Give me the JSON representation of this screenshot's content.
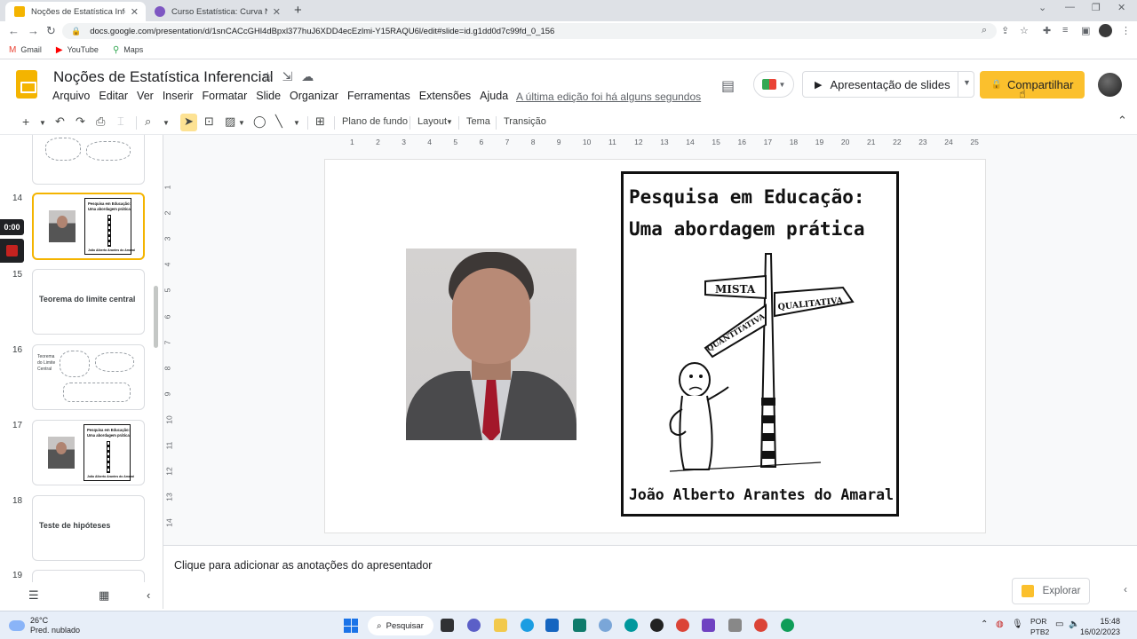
{
  "browser": {
    "tabs": [
      {
        "title": "Noções de Estatística Inferencial",
        "active": true
      },
      {
        "title": "Curso Estatística: Curva Normal",
        "active": false
      }
    ],
    "url": "docs.google.com/presentation/d/1snCACcGHl4dBpxl377huJ6XDD4ecEzlmi-Y15RAQU6l/edit#slide=id.g1dd0d7c99fd_0_156",
    "bookmarks": [
      "Gmail",
      "YouTube",
      "Maps"
    ]
  },
  "doc": {
    "title": "Noções de Estatística Inferencial",
    "menu": [
      "Arquivo",
      "Editar",
      "Ver",
      "Inserir",
      "Formatar",
      "Slide",
      "Organizar",
      "Ferramentas",
      "Extensões",
      "Ajuda"
    ],
    "last_edit": "A última edição foi há alguns segundos",
    "present_label": "Apresentação de slides",
    "share_label": "Compartilhar"
  },
  "toolbar": {
    "background": "Plano de fundo",
    "layout": "Layout",
    "theme": "Tema",
    "transition": "Transição"
  },
  "filmstrip": {
    "timer": "0:00",
    "slides": [
      {
        "num": "14",
        "selected": true
      },
      {
        "num": "15",
        "text": "Teorema do limite central"
      },
      {
        "num": "16",
        "text": "Teorema do Limite Central"
      },
      {
        "num": "17"
      },
      {
        "num": "18",
        "text": "Teste de hipóteses"
      },
      {
        "num": "19"
      }
    ],
    "book_thumb_title": "Pesquisa em Educação: Uma abordagem prática",
    "book_thumb_author": "João Alberto Arantes do Amaral"
  },
  "ruler": {
    "top": [
      "1",
      "2",
      "3",
      "4",
      "5",
      "6",
      "7",
      "8",
      "9",
      "10",
      "11",
      "12",
      "13",
      "14",
      "15",
      "16",
      "17",
      "18",
      "19",
      "20",
      "21",
      "22",
      "23",
      "24",
      "25"
    ],
    "left": [
      "1",
      "2",
      "3",
      "4",
      "5",
      "6",
      "7",
      "8",
      "9",
      "10",
      "11",
      "12",
      "13",
      "14"
    ]
  },
  "slide": {
    "book_title_line1": "Pesquisa em Educação:",
    "book_title_line2": "Uma abordagem prática",
    "sign_mista": "MISTA",
    "sign_qualitativa": "QUALITATIVA",
    "sign_quantitativa": "QUANTITATIVA",
    "book_author": "João Alberto Arantes do Amaral"
  },
  "notes": {
    "placeholder": "Clique para adicionar as anotações do apresentador",
    "explore_label": "Explorar"
  },
  "taskbar": {
    "temperature": "26°C",
    "weather": "Pred. nublado",
    "search": "Pesquisar",
    "lang1": "POR",
    "lang2": "PTB2",
    "time": "15:48",
    "date": "16/02/2023"
  }
}
